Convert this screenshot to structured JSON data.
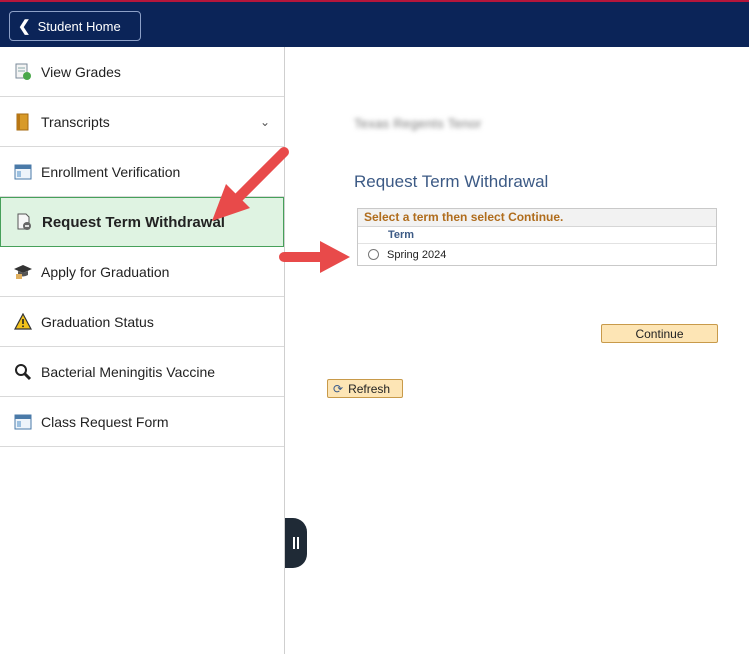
{
  "header": {
    "home_label": "Student Home"
  },
  "sidebar": {
    "items": [
      {
        "label": "View Grades",
        "icon": "grades-icon"
      },
      {
        "label": "Transcripts",
        "icon": "transcript-book-icon"
      },
      {
        "label": "Enrollment Verification",
        "icon": "window-icon"
      },
      {
        "label": "Request Term Withdrawal",
        "icon": "withdraw-document-icon"
      },
      {
        "label": "Apply for Graduation",
        "icon": "graduation-cap-icon"
      },
      {
        "label": "Graduation Status",
        "icon": "warning-icon"
      },
      {
        "label": "Bacterial Meningitis Vaccine",
        "icon": "magnifier-icon"
      },
      {
        "label": "Class Request Form",
        "icon": "window-icon"
      }
    ]
  },
  "main": {
    "blurred_text": "Texas Regents Tenor",
    "title": "Request Term Withdrawal",
    "term_box": {
      "instruction": "Select a term then select Continue.",
      "column_header": "Term",
      "rows": [
        {
          "term": "Spring 2024",
          "selected": false
        }
      ]
    },
    "continue_label": "Continue",
    "refresh_label": "Refresh"
  },
  "colors": {
    "header_bg": "#0b2458",
    "accent_red": "#b5163b",
    "active_bg": "#dff3e2",
    "button_bg": "#fde5b5",
    "arrow": "#e84a4a"
  }
}
